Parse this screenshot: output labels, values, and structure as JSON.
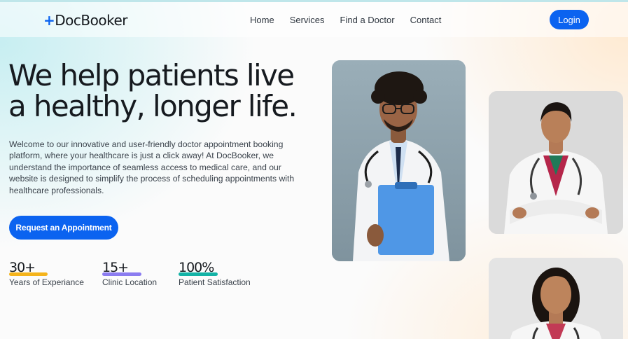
{
  "header": {
    "logo_plus": "+",
    "logo_text": "DocBooker",
    "nav": [
      "Home",
      "Services",
      "Find a Doctor",
      "Contact"
    ],
    "login_label": "Login"
  },
  "hero": {
    "title_line1": "We help patients live",
    "title_line2": "a healthy, longer life.",
    "description": "Welcome to our innovative and user-friendly doctor appointment booking platform, where your healthcare is just a click away! At DocBooker, we understand the importance of seamless access to medical care, and our website is designed to simplify the process of scheduling appointments with healthcare professionals.",
    "cta_label": "Request an Appointment"
  },
  "stats": [
    {
      "value": "30+",
      "label": "Years of Experiance",
      "color": "#f5b41c"
    },
    {
      "value": "15+",
      "label": "Clinic Location",
      "color": "#8b7cf0"
    },
    {
      "value": "100%",
      "label": "Patient Satisfaction",
      "color": "#13b3a6"
    }
  ],
  "colors": {
    "primary": "#0b63f0",
    "heading": "#161a1f",
    "body_text": "#3b434c"
  },
  "images": {
    "main": "doctor-male-with-clipboard-photo",
    "top_right": "doctor-female-arms-crossed-photo",
    "bottom_right": "doctor-female-smiling-photo"
  }
}
